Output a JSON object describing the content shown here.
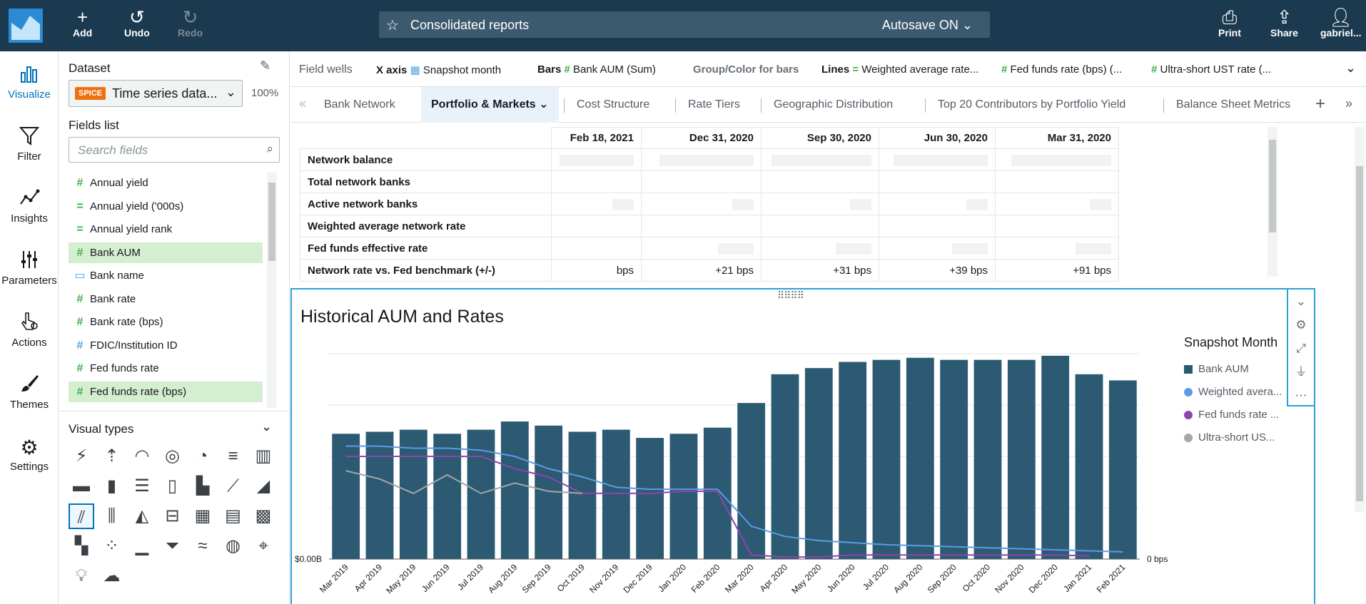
{
  "topbar": {
    "add": "Add",
    "undo": "Undo",
    "redo": "Redo",
    "title": "Consolidated reports",
    "autosave": "Autosave ON",
    "print": "Print",
    "share": "Share",
    "user": "gabriel..."
  },
  "nav": [
    "Visualize",
    "Filter",
    "Insights",
    "Parameters",
    "Actions",
    "Themes",
    "Settings"
  ],
  "dataset": {
    "label": "Dataset",
    "badge": "SPICE",
    "name": "Time series data...",
    "percent": "100%"
  },
  "fields": {
    "label": "Fields list",
    "search_placeholder": "Search fields",
    "items": [
      {
        "name": "Annual yield",
        "icon": "hash",
        "selected": false
      },
      {
        "name": "Annual yield ('000s)",
        "icon": "equals",
        "selected": false
      },
      {
        "name": "Annual yield rank",
        "icon": "equals",
        "selected": false
      },
      {
        "name": "Bank AUM",
        "icon": "hash",
        "selected": true
      },
      {
        "name": "Bank name",
        "icon": "tag",
        "selected": false
      },
      {
        "name": "Bank rate",
        "icon": "hash",
        "selected": false
      },
      {
        "name": "Bank rate (bps)",
        "icon": "hash",
        "selected": false
      },
      {
        "name": "FDIC/Institution ID",
        "icon": "hash-blue",
        "selected": false
      },
      {
        "name": "Fed funds rate",
        "icon": "hash",
        "selected": false
      },
      {
        "name": "Fed funds rate (bps)",
        "icon": "hash",
        "selected": true
      }
    ]
  },
  "visual_types": {
    "label": "Visual types"
  },
  "field_wells": {
    "label": "Field wells",
    "xaxis_label": "X axis",
    "xaxis_value": "Snapshot month",
    "bars_label": "Bars",
    "bars_value": "Bank AUM (Sum)",
    "group_label": "Group/Color for bars",
    "lines_label": "Lines",
    "line1": "Weighted average rate...",
    "line2": "Fed funds rate (bps) (...",
    "line3": "Ultra-short UST rate (..."
  },
  "tabs": [
    "Bank Network",
    "Portfolio & Markets",
    "Cost Structure",
    "Rate Tiers",
    "Geographic Distribution",
    "Top 20 Contributors by Portfolio Yield",
    "Balance Sheet Metrics"
  ],
  "table": {
    "columns": [
      "Feb 18, 2021",
      "Dec 31, 2020",
      "Sep 30, 2020",
      "Jun 30, 2020",
      "Mar 31, 2020"
    ],
    "rows": [
      {
        "label": "Network balance",
        "values": [
          "",
          "",
          "",
          "",
          ""
        ]
      },
      {
        "label": "Total network banks",
        "values": [
          "",
          "",
          "",
          "",
          ""
        ]
      },
      {
        "label": "Active network banks",
        "values": [
          "",
          "",
          "",
          "",
          ""
        ]
      },
      {
        "label": "Weighted average network rate",
        "values": [
          "",
          "",
          "",
          "",
          ""
        ]
      },
      {
        "label": "Fed funds effective rate",
        "values": [
          "",
          "",
          "",
          "",
          ""
        ]
      },
      {
        "label": "Network rate vs. Fed benchmark (+/-)",
        "values": [
          "bps",
          "+21 bps",
          "+31 bps",
          "+39 bps",
          "+91 bps"
        ]
      }
    ]
  },
  "visual": {
    "title": "Historical AUM and Rates",
    "legend_title": "Snapshot Month",
    "legend": [
      {
        "name": "Bank AUM",
        "color": "#2c5a73",
        "shape": "square"
      },
      {
        "name": "Weighted avera...",
        "color": "#5c9be4",
        "shape": "circle"
      },
      {
        "name": "Fed funds rate ...",
        "color": "#8e44ad",
        "shape": "circle"
      },
      {
        "name": "Ultra-short US...",
        "color": "#a6a6a6",
        "shape": "circle"
      }
    ]
  },
  "chart_data": {
    "type": "bar",
    "categories": [
      "Mar 2019",
      "Apr 2019",
      "May 2019",
      "Jun 2019",
      "Jul 2019",
      "Aug 2019",
      "Sep 2019",
      "Oct 2019",
      "Nov 2019",
      "Dec 2019",
      "Jan 2020",
      "Feb 2020",
      "Mar 2020",
      "Apr 2020",
      "May 2020",
      "Jun 2020",
      "Jul 2020",
      "Aug 2020",
      "Sep 2020",
      "Oct 2020",
      "Nov 2020",
      "Dec 2020",
      "Jan 2021",
      "Feb 2021"
    ],
    "y_left_tick": "$0.00B",
    "y_right_tick": "0 bps",
    "series": [
      {
        "name": "Bank AUM",
        "type": "bar",
        "color": "#2c5a73",
        "values": [
          0.61,
          0.62,
          0.63,
          0.61,
          0.63,
          0.67,
          0.65,
          0.62,
          0.63,
          0.59,
          0.61,
          0.64,
          0.76,
          0.9,
          0.93,
          0.96,
          0.97,
          0.98,
          0.97,
          0.97,
          0.97,
          0.99,
          0.9,
          0.87
        ]
      },
      {
        "name": "Weighted avera...",
        "type": "line",
        "color": "#5c9be4",
        "values": [
          0.55,
          0.55,
          0.54,
          0.54,
          0.53,
          0.5,
          0.44,
          0.4,
          0.35,
          0.34,
          0.34,
          0.34,
          0.16,
          0.11,
          0.09,
          0.08,
          0.07,
          0.065,
          0.06,
          0.055,
          0.05,
          0.045,
          0.04,
          0.035
        ]
      },
      {
        "name": "Fed funds rate ...",
        "type": "line",
        "color": "#8e44ad",
        "values": [
          0.5,
          0.5,
          0.5,
          0.5,
          0.5,
          0.44,
          0.4,
          0.32,
          0.32,
          0.32,
          0.33,
          0.33,
          0.02,
          0.01,
          0.01,
          0.02,
          0.02,
          0.02,
          0.02,
          0.02,
          0.02,
          0.02,
          0.015,
          null
        ]
      },
      {
        "name": "Ultra-short US...",
        "type": "line",
        "color": "#a6a6a6",
        "values": [
          0.43,
          0.39,
          0.32,
          0.41,
          0.32,
          0.37,
          0.33,
          0.32,
          null,
          null,
          null,
          null,
          null,
          null,
          null,
          null,
          null,
          null,
          null,
          null,
          null,
          null,
          null,
          null
        ]
      }
    ]
  }
}
